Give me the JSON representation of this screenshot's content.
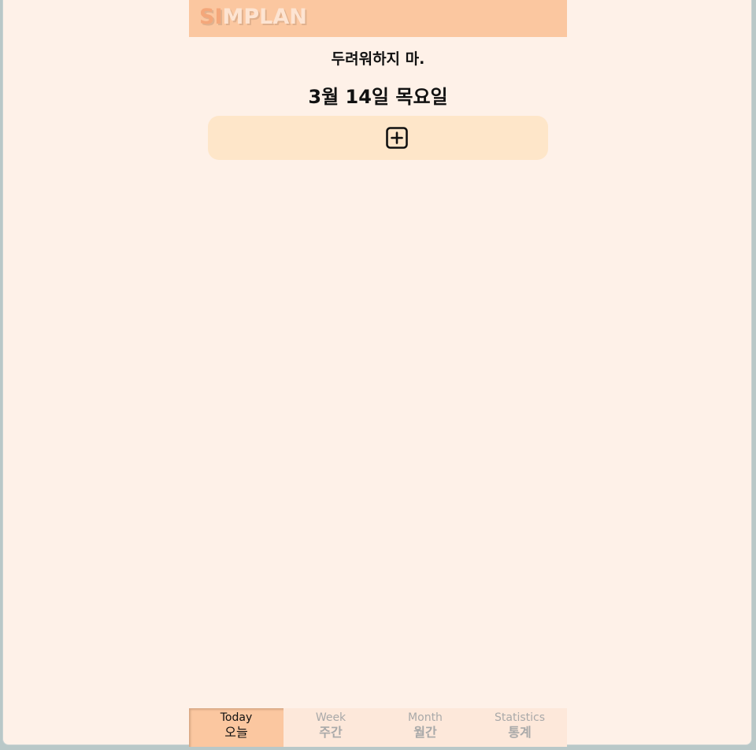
{
  "header": {
    "logo_part1": "SI",
    "logo_part2": "MPLAN"
  },
  "main": {
    "motto": "두려워하지 마.",
    "date": "3월 14일 목요일",
    "add_icon": "plus-square-icon"
  },
  "tabs": [
    {
      "en": "Today",
      "ko": "오늘",
      "active": true
    },
    {
      "en": "Week",
      "ko": "주간",
      "active": false
    },
    {
      "en": "Month",
      "ko": "월간",
      "active": false
    },
    {
      "en": "Statistics",
      "ko": "통계",
      "active": false
    }
  ],
  "colors": {
    "header_bg": "#fbc7a0",
    "page_bg": "#fef1e8",
    "add_bar_bg": "#fee6c9",
    "tab_bg": "#fde8da",
    "logo_accent": "#f4a77a"
  }
}
